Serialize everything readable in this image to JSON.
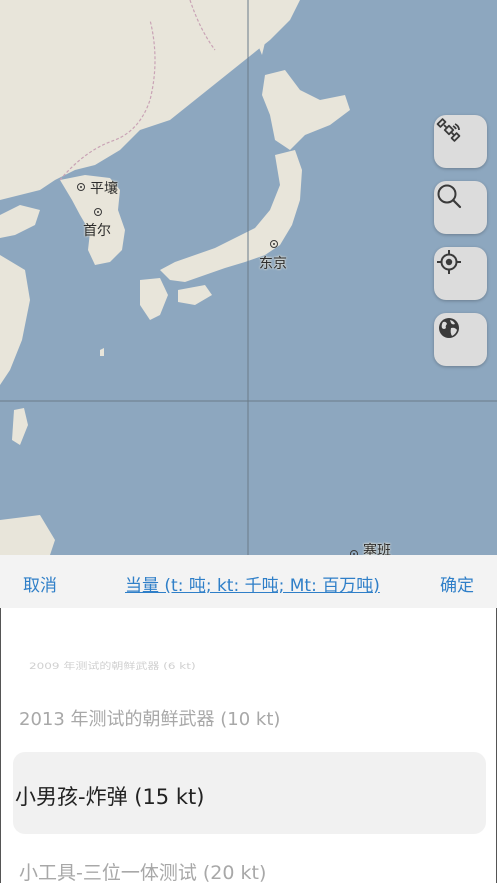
{
  "map": {
    "labels": {
      "pyongyang": "平壤",
      "seoul": "首尔",
      "tokyo": "东京",
      "saipan": "塞班"
    },
    "colors": {
      "water": "#8da7bf",
      "land": "#e8e5da"
    },
    "controls": [
      {
        "name": "satellite-layer-button",
        "icon": "satellite-icon"
      },
      {
        "name": "search-button",
        "icon": "search-icon"
      },
      {
        "name": "locate-button",
        "icon": "crosshair-icon"
      },
      {
        "name": "globe-button",
        "icon": "globe-icon"
      }
    ]
  },
  "toolbar": {
    "cancel": "取消",
    "title": "当量 (t: 吨; kt: 千吨; Mt: 百万吨)",
    "confirm": "确定",
    "accent": "#2f7fc8"
  },
  "picker": {
    "options": [
      "2009 年测试的朝鲜武器 (6 kt)",
      "2013 年测试的朝鲜武器 (10 kt)",
      "小男孩-炸弹 (15 kt)",
      "小工具-三位一体测试 (20 kt)"
    ],
    "selected": "小男孩-炸弹 (15 kt)"
  }
}
